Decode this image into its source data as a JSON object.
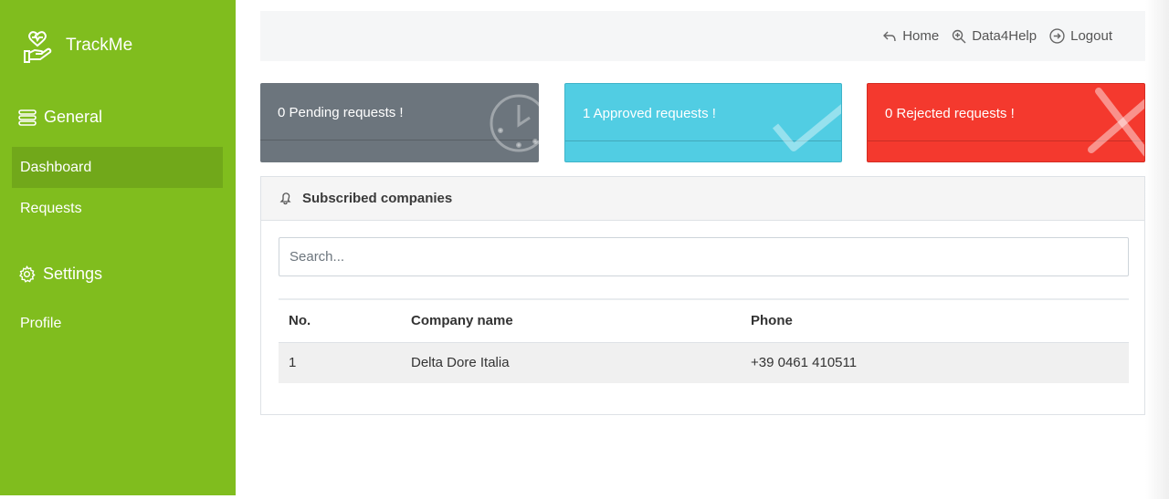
{
  "app": {
    "title": "TrackMe"
  },
  "sidebar": {
    "general_label": "General",
    "settings_label": "Settings",
    "items": [
      {
        "label": "Dashboard",
        "active": true
      },
      {
        "label": "Requests",
        "active": false
      },
      {
        "label": "Profile",
        "active": false
      }
    ]
  },
  "topnav": {
    "home": "Home",
    "data4help": "Data4Help",
    "logout": "Logout"
  },
  "cards": {
    "pending": "0 Pending requests !",
    "approved": "1 Approved requests !",
    "rejected": "0 Rejected requests !"
  },
  "panel": {
    "title": "Subscribed companies",
    "search_placeholder": "Search...",
    "columns": [
      "No.",
      "Company name",
      "Phone"
    ],
    "rows": [
      [
        "1",
        "Delta Dore Italia",
        "+39 0461 410511"
      ]
    ]
  },
  "colors": {
    "sidebar": "#80bd1e",
    "active_item": "#71a81a",
    "pending": "#6c757d",
    "approved": "#51cde3",
    "rejected": "#f4392e"
  }
}
